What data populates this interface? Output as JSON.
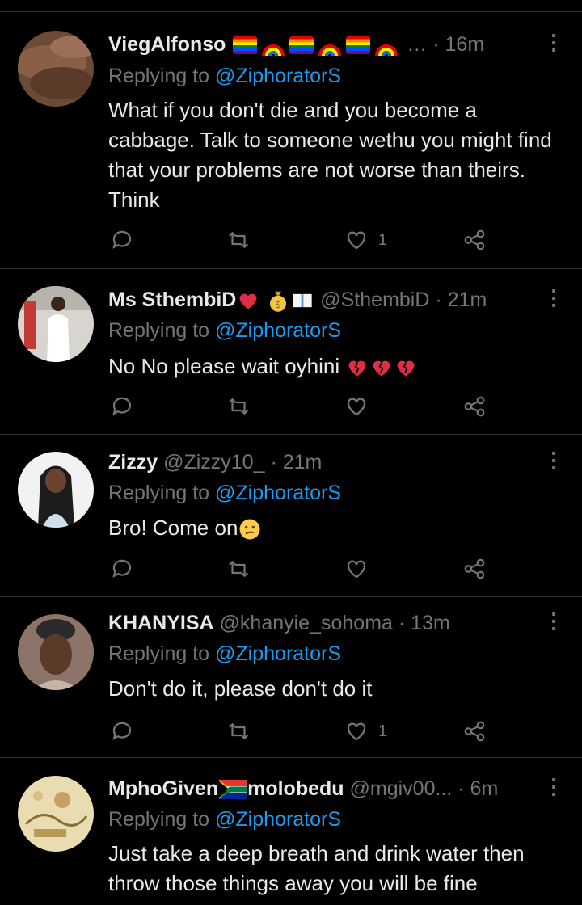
{
  "tweets": [
    {
      "name": "ViegAlfonso",
      "handle": "",
      "ellipsis": "…",
      "time": "16m",
      "replying_prefix": "Replying to",
      "mention": "@ZiphoratorS",
      "text": "What if you don't die and you become a cabbage. Talk to someone wethu you might find that your problems are not worse than theirs. Think",
      "replies": "",
      "retweets": "",
      "likes": "1"
    },
    {
      "name": "Ms SthembiD",
      "handle": "@SthembiD",
      "time": "21m",
      "replying_prefix": "Replying to",
      "mention": "@ZiphoratorS",
      "text": "No No please wait oyhini",
      "likes": ""
    },
    {
      "name": "Zizzy",
      "handle": "@Zizzy10_",
      "time": "21m",
      "replying_prefix": "Replying to",
      "mention": "@ZiphoratorS",
      "text": "Bro! Come on",
      "likes": ""
    },
    {
      "name": "KHANYISA",
      "handle": "@khanyie_sohoma",
      "time": "13m",
      "replying_prefix": "Replying to",
      "mention": "@ZiphoratorS",
      "text": "Don't do it, please don't do it",
      "likes": "1"
    },
    {
      "name": "MphoGiven",
      "name_suffix": "molobedu",
      "handle": "@mgiv00...",
      "time": "6m",
      "replying_prefix": "Replying to",
      "mention": "@ZiphoratorS",
      "text": "Just take a deep breath and drink water then throw those things away you will be fine",
      "likes": ""
    }
  ],
  "ui": {
    "separator_dot": "·",
    "more_label": "⋮"
  },
  "colors": {
    "background": "#000000",
    "text": "#e7e9ea",
    "secondary": "#71767b",
    "accent": "#1d9bf0",
    "divider": "#2f3336"
  }
}
